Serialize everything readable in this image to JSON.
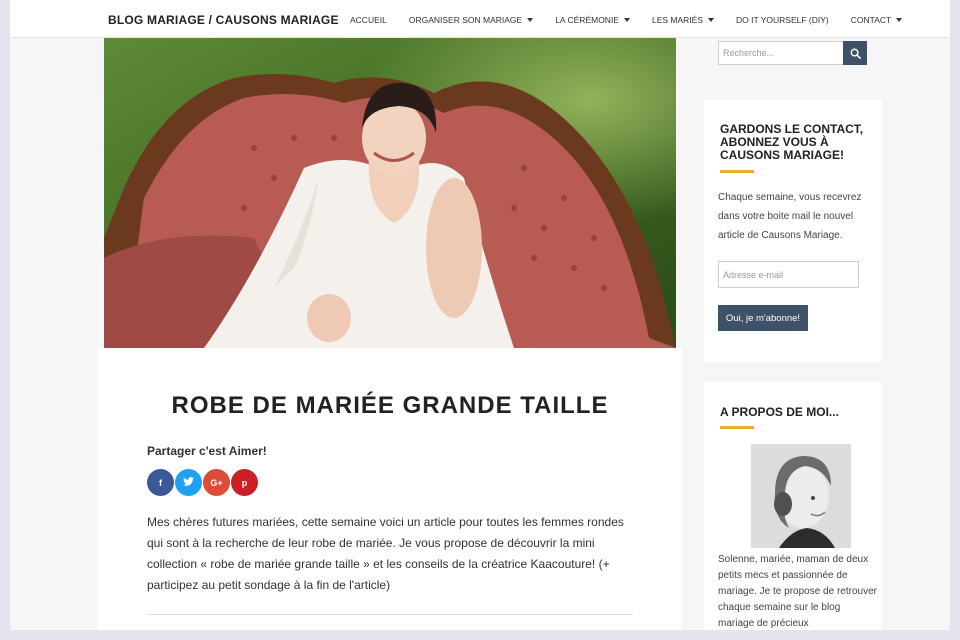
{
  "header": {
    "brand": "BLOG MARIAGE / CAUSONS MARIAGE",
    "nav": [
      {
        "label": "ACCUEIL",
        "dropdown": false
      },
      {
        "label": "ORGANISER SON MARIAGE",
        "dropdown": true
      },
      {
        "label": "LA CÉRÉMONIE",
        "dropdown": true
      },
      {
        "label": "LES MARIÉS",
        "dropdown": true
      },
      {
        "label": "DO IT YOURSELF (DIY)",
        "dropdown": false
      },
      {
        "label": "CONTACT",
        "dropdown": true
      }
    ]
  },
  "article": {
    "title": "ROBE DE MARIÉE GRANDE TAILLE",
    "share_label": "Partager c'est Aimer!",
    "share_buttons": [
      {
        "network": "facebook",
        "glyph": "f"
      },
      {
        "network": "twitter",
        "glyph": "t"
      },
      {
        "network": "google-plus",
        "glyph": "G+"
      },
      {
        "network": "pinterest",
        "glyph": "p"
      }
    ],
    "intro": "Mes chères futures mariées, cette semaine voici un article pour toutes les femmes rondes qui sont à la recherche de leur robe de mariée. Je vous propose de découvrir la mini collection « robe de mariée grande taille » et les conseils de la créatrice Kaacouture! (+ participez au petit sondage à la fin de l'article)"
  },
  "sidebar": {
    "search_placeholder": "Recherche...",
    "newsletter": {
      "title": "GARDONS LE CONTACT, ABONNEZ VOUS À CAUSONS MARIAGE!",
      "text": "Chaque semaine, vous recevrez dans votre boite mail le nouvel article de Causons Mariage.",
      "email_placeholder": "Adresse e-mail",
      "button": "Oui, je m'abonne!"
    },
    "about": {
      "title": "A PROPOS DE MOI...",
      "text": "Solenne, mariée, maman de deux petits mecs et passionnée de mariage. Je te propose de retrouver chaque semaine sur le blog mariage de précieux"
    }
  },
  "colors": {
    "accent": "#e0b22e",
    "button": "#3d5268",
    "facebook": "#3b5998",
    "twitter": "#1da1f2",
    "google_plus": "#dd4b39",
    "pinterest": "#cb2027"
  }
}
